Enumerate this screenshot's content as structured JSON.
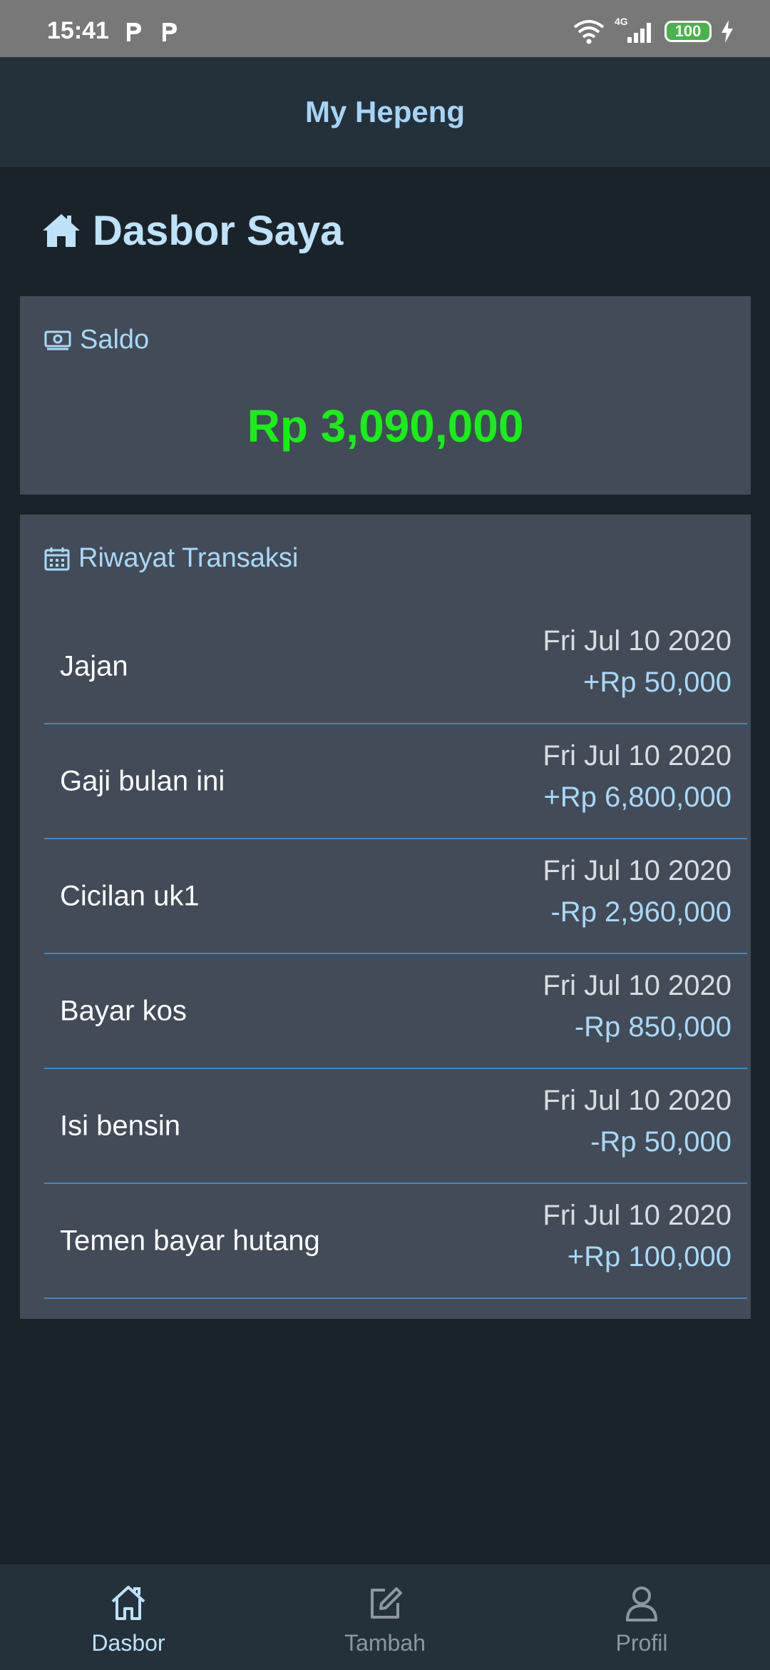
{
  "status_bar": {
    "time": "15:41",
    "network": "4G",
    "battery": "100"
  },
  "app_bar": {
    "title": "My Hepeng"
  },
  "dashboard": {
    "title": "Dasbor Saya"
  },
  "balance": {
    "label": "Saldo",
    "amount": "Rp 3,090,000"
  },
  "transactions": {
    "label": "Riwayat Transaksi",
    "items": [
      {
        "name": "Jajan",
        "date": "Fri Jul 10 2020",
        "amount": "+Rp 50,000"
      },
      {
        "name": "Gaji bulan ini",
        "date": "Fri Jul 10 2020",
        "amount": "+Rp 6,800,000"
      },
      {
        "name": "Cicilan uk1",
        "date": "Fri Jul 10 2020",
        "amount": "-Rp 2,960,000"
      },
      {
        "name": "Bayar kos",
        "date": "Fri Jul 10 2020",
        "amount": "-Rp 850,000"
      },
      {
        "name": "Isi bensin",
        "date": "Fri Jul 10 2020",
        "amount": "-Rp 50,000"
      },
      {
        "name": "Temen bayar hutang",
        "date": "Fri Jul 10 2020",
        "amount": "+Rp 100,000"
      }
    ]
  },
  "bottom_nav": {
    "items": [
      {
        "label": "Dasbor",
        "icon": "home-icon",
        "active": true
      },
      {
        "label": "Tambah",
        "icon": "edit-icon",
        "active": false
      },
      {
        "label": "Profil",
        "icon": "user-icon",
        "active": false
      }
    ]
  },
  "colors": {
    "balance_green": "#19ee19",
    "accent_blue": "#a9d8f8",
    "divider": "#3f87c3"
  }
}
